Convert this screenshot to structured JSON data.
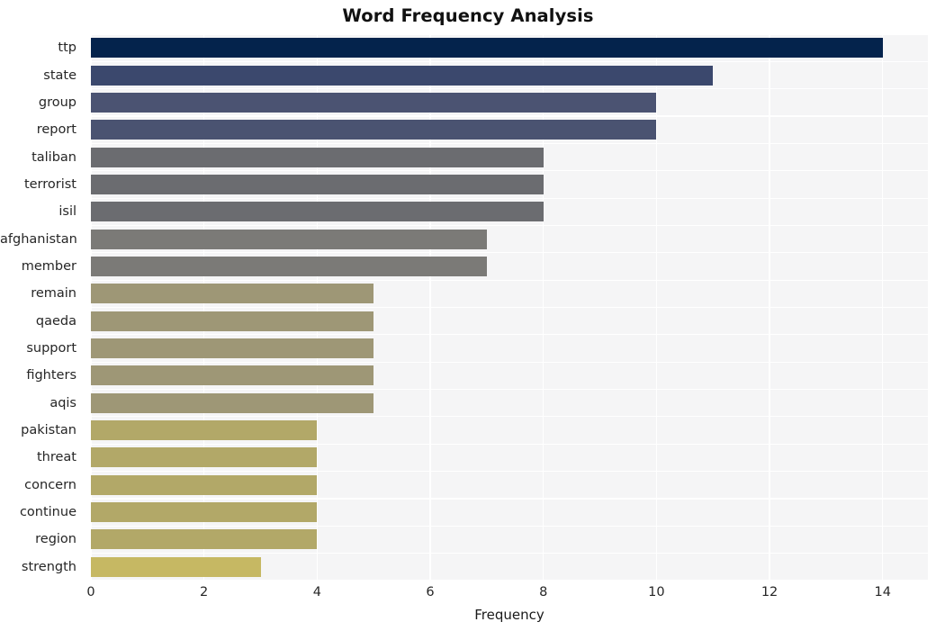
{
  "chart_data": {
    "type": "bar",
    "orientation": "horizontal",
    "title": "Word Frequency Analysis",
    "xlabel": "Frequency",
    "ylabel": "",
    "xlim": [
      0,
      14.8
    ],
    "ylim": [
      0,
      20
    ],
    "grid": true,
    "legend": null,
    "xticks": [
      "0",
      "2",
      "4",
      "6",
      "8",
      "10",
      "12",
      "14"
    ],
    "xtick_values": [
      0,
      2,
      4,
      6,
      8,
      10,
      12,
      14
    ],
    "categories": [
      "ttp",
      "state",
      "group",
      "report",
      "taliban",
      "terrorist",
      "isil",
      "afghanistan",
      "member",
      "remain",
      "qaeda",
      "support",
      "fighters",
      "aqis",
      "pakistan",
      "threat",
      "concern",
      "continue",
      "region",
      "strength"
    ],
    "values": [
      14,
      11,
      10,
      10,
      8,
      8,
      8,
      7,
      7,
      5,
      5,
      5,
      5,
      5,
      4,
      4,
      4,
      4,
      4,
      3
    ],
    "bar_colors": [
      "#04234c",
      "#3b486d",
      "#4b5372",
      "#4a5371",
      "#6b6c70",
      "#6b6c70",
      "#6b6c70",
      "#7b7a77",
      "#7b7a77",
      "#9e9776",
      "#9e9776",
      "#9e9776",
      "#9e9776",
      "#9e9776",
      "#b2a868",
      "#b2a868",
      "#b2a868",
      "#b2a868",
      "#b2a868",
      "#c6b863"
    ]
  },
  "style": {
    "figure_background": "#ffffff",
    "axes_background": "#f5f5f6",
    "gridline_color": "#ffffff",
    "tick_label_color": "#262626",
    "title_color": "#111111"
  }
}
